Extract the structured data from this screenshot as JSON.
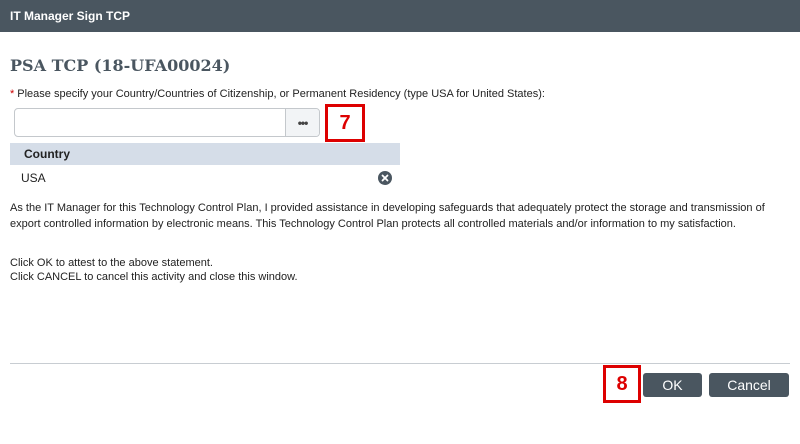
{
  "window": {
    "title": "IT Manager Sign TCP"
  },
  "form": {
    "heading": "PSA TCP (18-UFA00024)",
    "required_marker": "*",
    "prompt": "Please specify your Country/Countries of Citizenship, or Permanent Residency (type USA for United States):",
    "country_input": {
      "value": "",
      "placeholder": ""
    },
    "browse_label": "•••",
    "table": {
      "header": "Country",
      "rows": [
        {
          "country": "USA"
        }
      ]
    },
    "statement": "As the IT Manager for this Technology Control Plan, I provided assistance in developing safeguards that adequately protect the storage and transmission of export controlled information by electronic means. This Technology Control Plan protects all controlled materials and/or information to my satisfaction.",
    "instructions": [
      "Click OK to attest to the above statement.",
      "Click CANCEL to cancel this activity and close this window."
    ]
  },
  "callouts": {
    "input": "7",
    "ok": "8"
  },
  "buttons": {
    "ok": "OK",
    "cancel": "Cancel"
  },
  "icons": {
    "browse": "ellipsis-icon",
    "remove": "remove-circle-icon"
  },
  "colors": {
    "titlebar": "#4a5660",
    "button": "#4a5660",
    "table_header": "#d5dde8",
    "callout": "#dd0000",
    "required": "#cc0000"
  }
}
